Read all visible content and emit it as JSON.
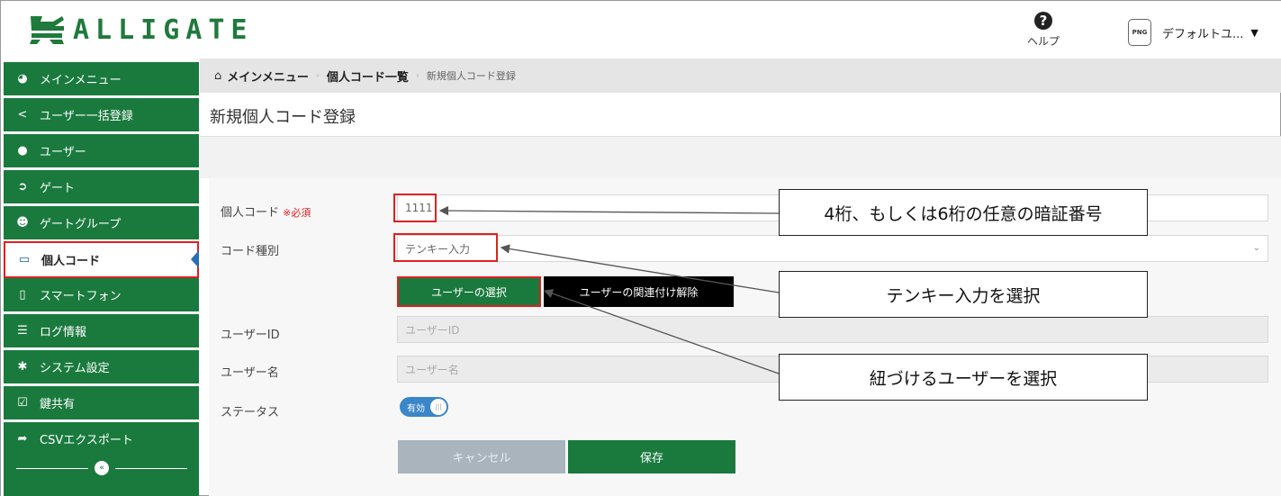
{
  "header": {
    "logo_text": "ALLIGATE",
    "help_label": "ヘルプ",
    "user_icon_text": "PNG",
    "user_name": "デフォルトユ..."
  },
  "sidebar": {
    "items": [
      {
        "label": "メインメニュー",
        "icon": "dashboard-icon"
      },
      {
        "label": "ユーザー一括登録",
        "icon": "share-icon"
      },
      {
        "label": "ユーザー",
        "icon": "user-icon"
      },
      {
        "label": "ゲート",
        "icon": "sign-in-icon"
      },
      {
        "label": "ゲートグループ",
        "icon": "users-icon"
      },
      {
        "label": "個人コード",
        "icon": "credit-card-icon"
      },
      {
        "label": "スマートフォン",
        "icon": "smartphone-icon"
      },
      {
        "label": "ログ情報",
        "icon": "list-icon"
      },
      {
        "label": "システム設定",
        "icon": "gear-icon"
      },
      {
        "label": "鍵共有",
        "icon": "checkbox-icon"
      },
      {
        "label": "CSVエクスポート",
        "icon": "share-arrow-icon"
      }
    ]
  },
  "breadcrumb": {
    "home": "メインメニュー",
    "middle": "個人コード一覧",
    "current": "新規個人コード登録"
  },
  "page": {
    "title": "新規個人コード登録"
  },
  "form": {
    "code_label": "個人コード",
    "required_mark": "※必須",
    "code_value": "1111",
    "type_label": "コード種別",
    "type_value": "テンキー入力",
    "select_user_button": "ユーザーの選択",
    "unlink_user_button": "ユーザーの関連付け解除",
    "user_id_label": "ユーザーID",
    "user_id_placeholder": "ユーザーID",
    "user_name_label": "ユーザー名",
    "user_name_placeholder": "ユーザー名",
    "status_label": "ステータス",
    "status_toggle_text": "有効",
    "cancel_button": "キャンセル",
    "save_button": "保存"
  },
  "annotations": {
    "callout_code": "4桁、もしくは6桁の任意の暗証番号",
    "callout_type": "テンキー入力を選択",
    "callout_user": "紐づけるユーザーを選択"
  },
  "colors": {
    "brand_green": "#1a7a3e",
    "highlight_red": "#e02020",
    "toggle_blue": "#3a86c8"
  }
}
